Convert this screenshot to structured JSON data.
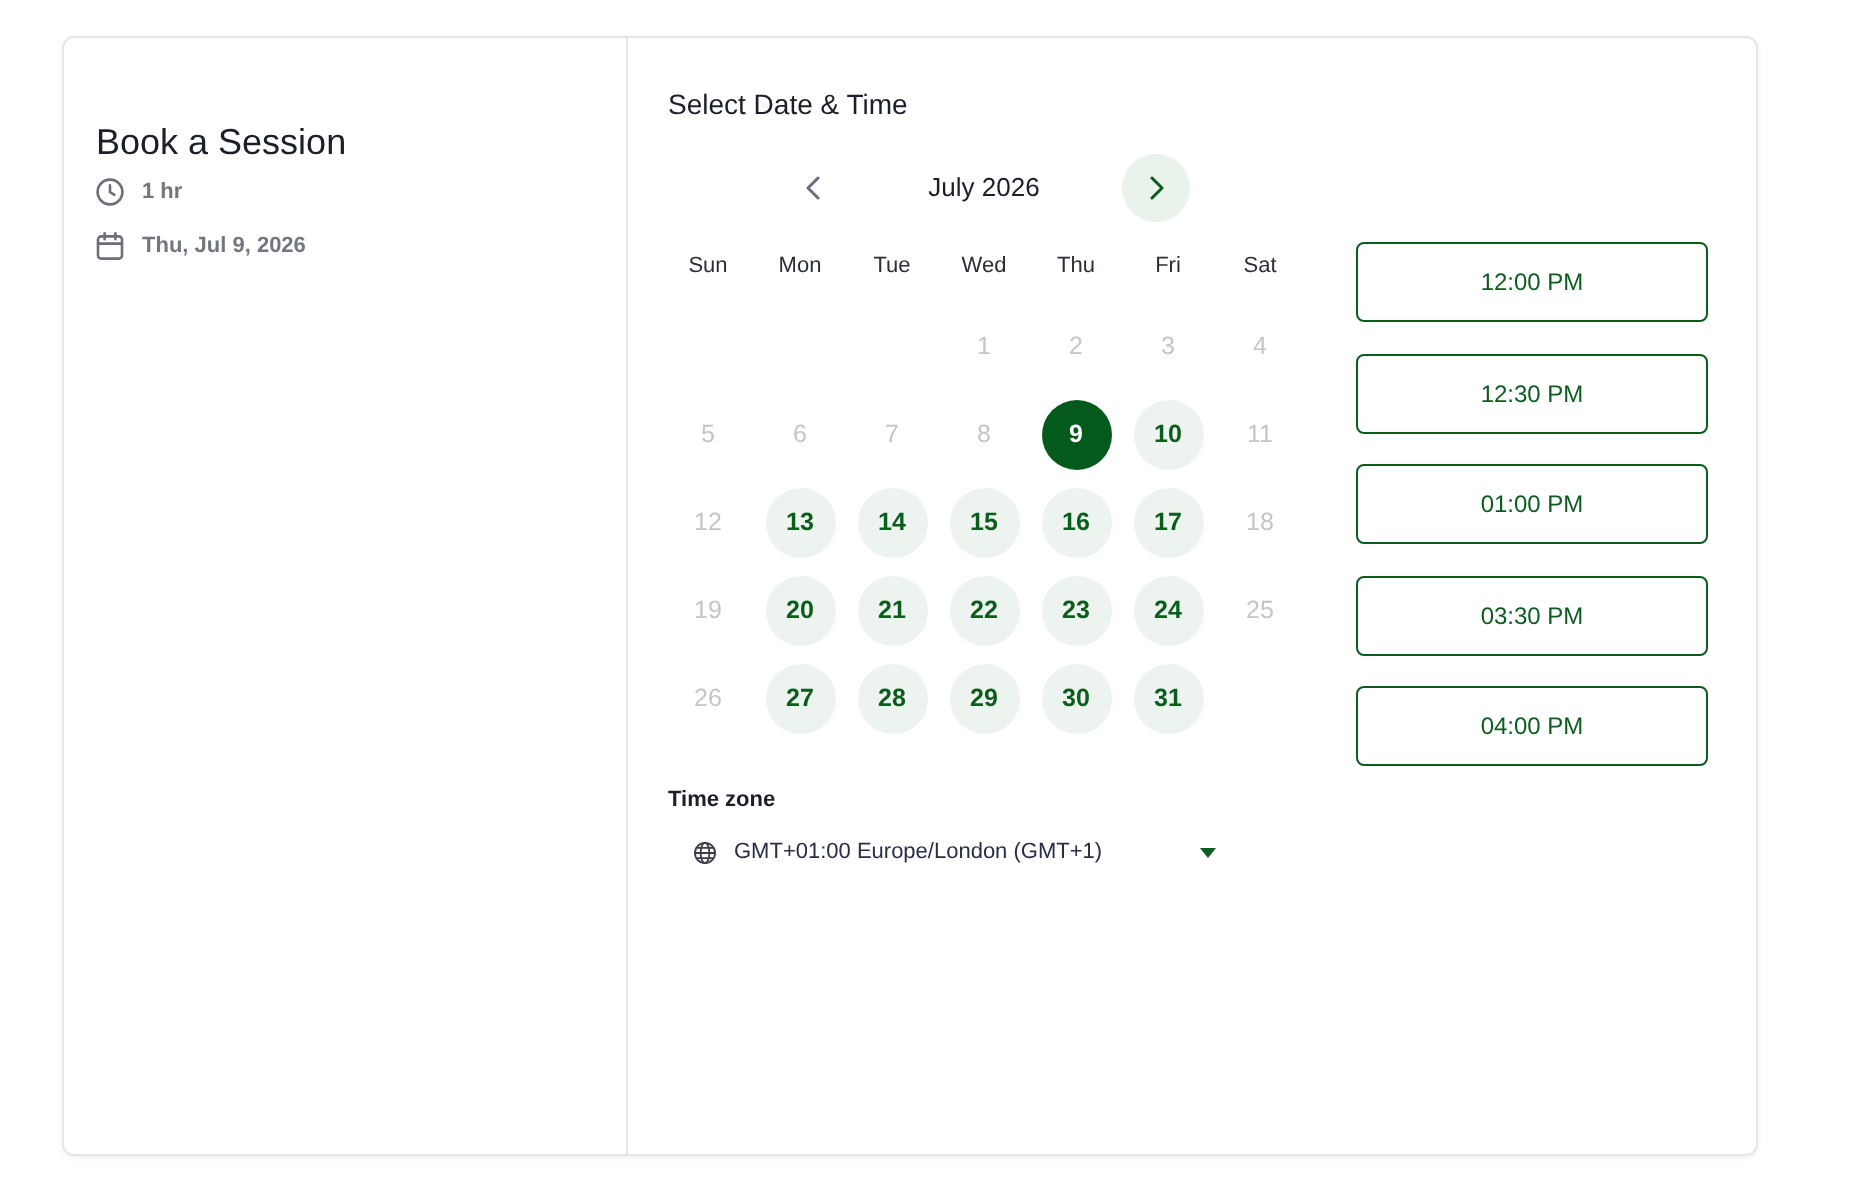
{
  "sidebar": {
    "title": "Book a Session",
    "details": [
      {
        "kind": "duration",
        "text": "1 hr"
      },
      {
        "kind": "date",
        "text": "Thu, Jul 9, 2026"
      }
    ]
  },
  "picker": {
    "heading": "Select Date & Time",
    "calendar": {
      "month": "July 2026",
      "prev": {
        "disabled": true
      },
      "next": {
        "disabled": false
      },
      "weekdays": [
        "Sun",
        "Mon",
        "Tue",
        "Wed",
        "Thu",
        "Fri",
        "Sat"
      ],
      "weeks": [
        {
          "days": [
            {
              "kind": "blank"
            },
            {
              "kind": "blank"
            },
            {
              "kind": "blank"
            },
            {
              "kind": "day",
              "label": "1",
              "available": false,
              "selected": false
            },
            {
              "kind": "day",
              "label": "2",
              "available": false,
              "selected": false
            },
            {
              "kind": "day",
              "label": "3",
              "available": false,
              "selected": false
            },
            {
              "kind": "day",
              "label": "4",
              "available": false,
              "selected": false
            }
          ]
        },
        {
          "days": [
            {
              "kind": "day",
              "label": "5",
              "available": false,
              "selected": false
            },
            {
              "kind": "day",
              "label": "6",
              "available": false,
              "selected": false
            },
            {
              "kind": "day",
              "label": "7",
              "available": false,
              "selected": false
            },
            {
              "kind": "day",
              "label": "8",
              "available": false,
              "selected": false
            },
            {
              "kind": "day",
              "label": "9",
              "available": true,
              "selected": true
            },
            {
              "kind": "day",
              "label": "10",
              "available": true,
              "selected": false
            },
            {
              "kind": "day",
              "label": "11",
              "available": false,
              "selected": false
            }
          ]
        },
        {
          "days": [
            {
              "kind": "day",
              "label": "12",
              "available": false,
              "selected": false
            },
            {
              "kind": "day",
              "label": "13",
              "available": true,
              "selected": false
            },
            {
              "kind": "day",
              "label": "14",
              "available": true,
              "selected": false
            },
            {
              "kind": "day",
              "label": "15",
              "available": true,
              "selected": false
            },
            {
              "kind": "day",
              "label": "16",
              "available": true,
              "selected": false
            },
            {
              "kind": "day",
              "label": "17",
              "available": true,
              "selected": false
            },
            {
              "kind": "day",
              "label": "18",
              "available": false,
              "selected": false
            }
          ]
        },
        {
          "days": [
            {
              "kind": "day",
              "label": "19",
              "available": false,
              "selected": false
            },
            {
              "kind": "day",
              "label": "20",
              "available": true,
              "selected": false
            },
            {
              "kind": "day",
              "label": "21",
              "available": true,
              "selected": false
            },
            {
              "kind": "day",
              "label": "22",
              "available": true,
              "selected": false
            },
            {
              "kind": "day",
              "label": "23",
              "available": true,
              "selected": false
            },
            {
              "kind": "day",
              "label": "24",
              "available": true,
              "selected": false
            },
            {
              "kind": "day",
              "label": "25",
              "available": false,
              "selected": false
            }
          ]
        },
        {
          "days": [
            {
              "kind": "day",
              "label": "26",
              "available": false,
              "selected": false
            },
            {
              "kind": "day",
              "label": "27",
              "available": true,
              "selected": false
            },
            {
              "kind": "day",
              "label": "28",
              "available": true,
              "selected": false
            },
            {
              "kind": "day",
              "label": "29",
              "available": true,
              "selected": false
            },
            {
              "kind": "day",
              "label": "30",
              "available": true,
              "selected": false
            },
            {
              "kind": "day",
              "label": "31",
              "available": true,
              "selected": false
            },
            {
              "kind": "blank"
            }
          ]
        }
      ]
    },
    "time_slots": [
      {
        "label": "12:00 PM",
        "selected": false
      },
      {
        "label": "12:30 PM",
        "selected": false
      },
      {
        "label": "01:00 PM",
        "selected": false
      },
      {
        "label": "03:30 PM",
        "selected": false
      },
      {
        "label": "04:00 PM",
        "selected": false
      }
    ],
    "time_zone": {
      "label": "Time zone",
      "value": "GMT+01:00 Europe/London (GMT+1)"
    }
  }
}
